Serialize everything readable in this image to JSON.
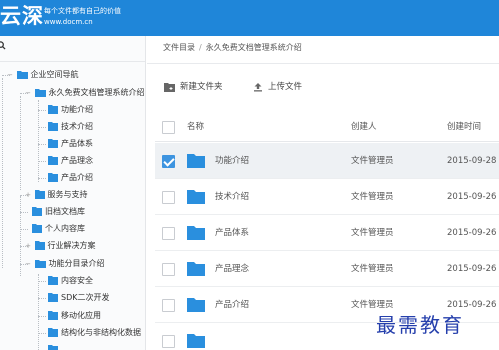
{
  "header": {
    "logo_main": "云深",
    "logo_tagline": "每个文件都有自己的价值",
    "logo_url": "www.docm.cn"
  },
  "sidebar": {
    "tree": [
      {
        "label": "企业空间导航",
        "level": 0,
        "expanded": true
      },
      {
        "label": "永久免费文档管理系统介绍",
        "level": 1,
        "expanded": true
      },
      {
        "label": "功能介绍",
        "level": 2
      },
      {
        "label": "技术介绍",
        "level": 2
      },
      {
        "label": "产品体系",
        "level": 2
      },
      {
        "label": "产品理念",
        "level": 2
      },
      {
        "label": "产品介绍",
        "level": 2
      },
      {
        "label": "服务与支持",
        "level": 1,
        "expanded": false
      },
      {
        "label": "旧档文档库",
        "level": 1
      },
      {
        "label": "个人内容库",
        "level": 1
      },
      {
        "label": "行业解决方案",
        "level": 1,
        "expanded": false
      },
      {
        "label": "功能分目录介绍",
        "level": 1,
        "expanded": true
      },
      {
        "label": "内容安全",
        "level": 2
      },
      {
        "label": "SDK二次开发",
        "level": 2
      },
      {
        "label": "移动化应用",
        "level": 2
      },
      {
        "label": "结构化与非结构化数据",
        "level": 2
      }
    ]
  },
  "main": {
    "breadcrumb": {
      "root": "文件目录",
      "current": "永久免费文档管理系统介绍"
    },
    "toolbar": {
      "new_folder": "新建文件夹",
      "upload": "上传文件"
    },
    "columns": {
      "name": "名称",
      "creator": "创建人",
      "created_time": "创建时间"
    },
    "rows": [
      {
        "name": "功能介绍",
        "creator": "文件管理员",
        "time": "2015-09-28",
        "selected": true
      },
      {
        "name": "技术介绍",
        "creator": "文件管理员",
        "time": "2015-09-26",
        "selected": false
      },
      {
        "name": "产品体系",
        "creator": "文件管理员",
        "time": "2015-09-26",
        "selected": false
      },
      {
        "name": "产品理念",
        "creator": "文件管理员",
        "time": "2015-09-26",
        "selected": false
      },
      {
        "name": "产品介绍",
        "creator": "文件管理员",
        "time": "2015-09-26",
        "selected": false
      }
    ]
  },
  "watermark": "最需教育",
  "colors": {
    "header": "#1f86d9",
    "folder": "#2a8fde",
    "selected_row": "#eef1f4",
    "checkbox_on": "#3d94e0"
  }
}
